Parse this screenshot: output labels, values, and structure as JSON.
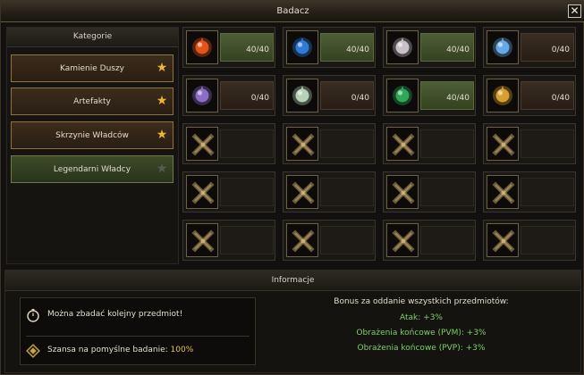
{
  "window": {
    "title": "Badacz",
    "close_label": "✕"
  },
  "categories": {
    "header": "Kategorie",
    "items": [
      {
        "label": "Kamienie Duszy",
        "selected": false
      },
      {
        "label": "Artefakty",
        "selected": false
      },
      {
        "label": "Skrzynie Władców",
        "selected": false
      },
      {
        "label": "Legendarni Władcy",
        "selected": true
      }
    ]
  },
  "slots": [
    {
      "state": "full",
      "count": "40/40",
      "icon": "fire-orb-icon",
      "color": "#e2541c"
    },
    {
      "state": "full",
      "count": "40/40",
      "icon": "ice-orb-icon",
      "color": "#2f7bd8"
    },
    {
      "state": "full",
      "count": "40/40",
      "icon": "skull-crest-icon",
      "color": "#c8c0c8"
    },
    {
      "state": "part",
      "count": "0/40",
      "icon": "frost-dragon-icon",
      "color": "#69a8e6"
    },
    {
      "state": "part",
      "count": "0/40",
      "icon": "dark-crystal-icon",
      "color": "#8a6ec8"
    },
    {
      "state": "part",
      "count": "0/40",
      "icon": "silver-emblem-icon",
      "color": "#b8d0b8"
    },
    {
      "state": "full",
      "count": "40/40",
      "icon": "jade-orb-icon",
      "color": "#2fa85a"
    },
    {
      "state": "part",
      "count": "0/40",
      "icon": "gold-medallion-icon",
      "color": "#d8a030"
    },
    {
      "state": "locked"
    },
    {
      "state": "locked"
    },
    {
      "state": "locked"
    },
    {
      "state": "locked"
    },
    {
      "state": "locked"
    },
    {
      "state": "locked"
    },
    {
      "state": "locked"
    },
    {
      "state": "locked"
    },
    {
      "state": "locked"
    },
    {
      "state": "locked"
    },
    {
      "state": "locked"
    },
    {
      "state": "locked"
    }
  ],
  "info": {
    "header": "Informacje",
    "can_research": "Można zbadać kolejny przedmiot!",
    "chance_label": "Szansa na pomyślne badanie:",
    "chance_value": "100%",
    "bonus_title": "Bonus za oddanie wszystkich przedmiotów:",
    "bonus_lines": [
      "Atak: +3%",
      "Obrażenia końcowe (PVM): +3%",
      "Obrażenia końcowe (PVP): +3%"
    ]
  }
}
